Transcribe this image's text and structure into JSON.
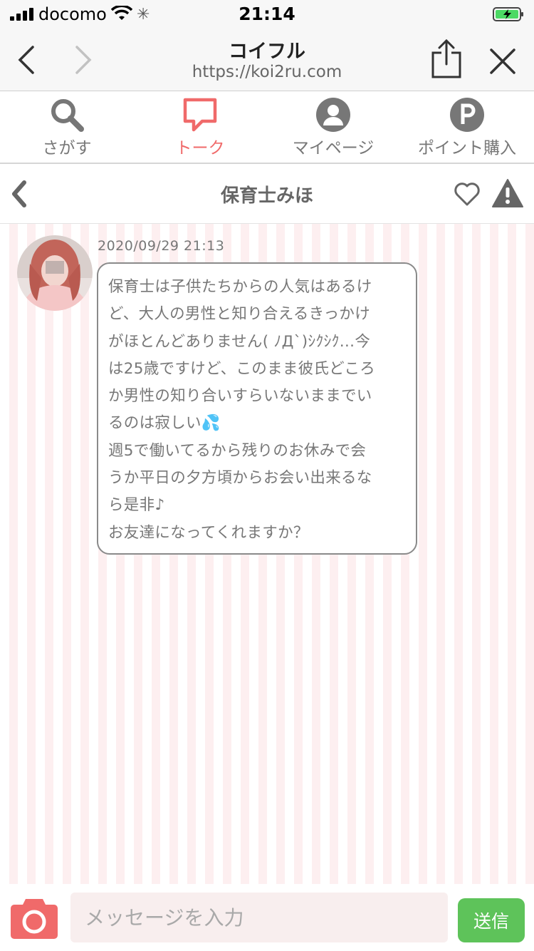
{
  "status_bar": {
    "carrier": "docomo",
    "time": "21:14"
  },
  "browser": {
    "title": "コイフル",
    "url": "https://koi2ru.com"
  },
  "tabs": [
    {
      "label": "さがす",
      "icon": "search-icon",
      "active": false
    },
    {
      "label": "トーク",
      "icon": "chat-icon",
      "active": true
    },
    {
      "label": "マイページ",
      "icon": "user-icon",
      "active": false
    },
    {
      "label": "ポイント購入",
      "icon": "points-icon",
      "active": false
    }
  ],
  "chat": {
    "partner_name": "保育士みほ",
    "messages": [
      {
        "timestamp": "2020/09/29 21:13",
        "lines": [
          "保育士は子供たちからの人気はあるけ",
          "ど、大人の男性と知り合えるきっかけ",
          "がほとんどありません( ﾉД`)ｼｸｼｸ…今",
          "は25歳ですけど、このまま彼氏どころ",
          "か男性の知り合いすらいないままでい",
          "るのは寂しい💦",
          "週5で働いてるから残りのお休みで会",
          "うか平日の夕方頃からお会い出来るな",
          "ら是非♪",
          "お友達になってくれますか？"
        ]
      }
    ]
  },
  "composer": {
    "placeholder": "メッセージを入力",
    "send_label": "送信"
  },
  "colors": {
    "accent": "#f06a6a",
    "send": "#5ec35a",
    "stripe": "#fdeff0"
  }
}
